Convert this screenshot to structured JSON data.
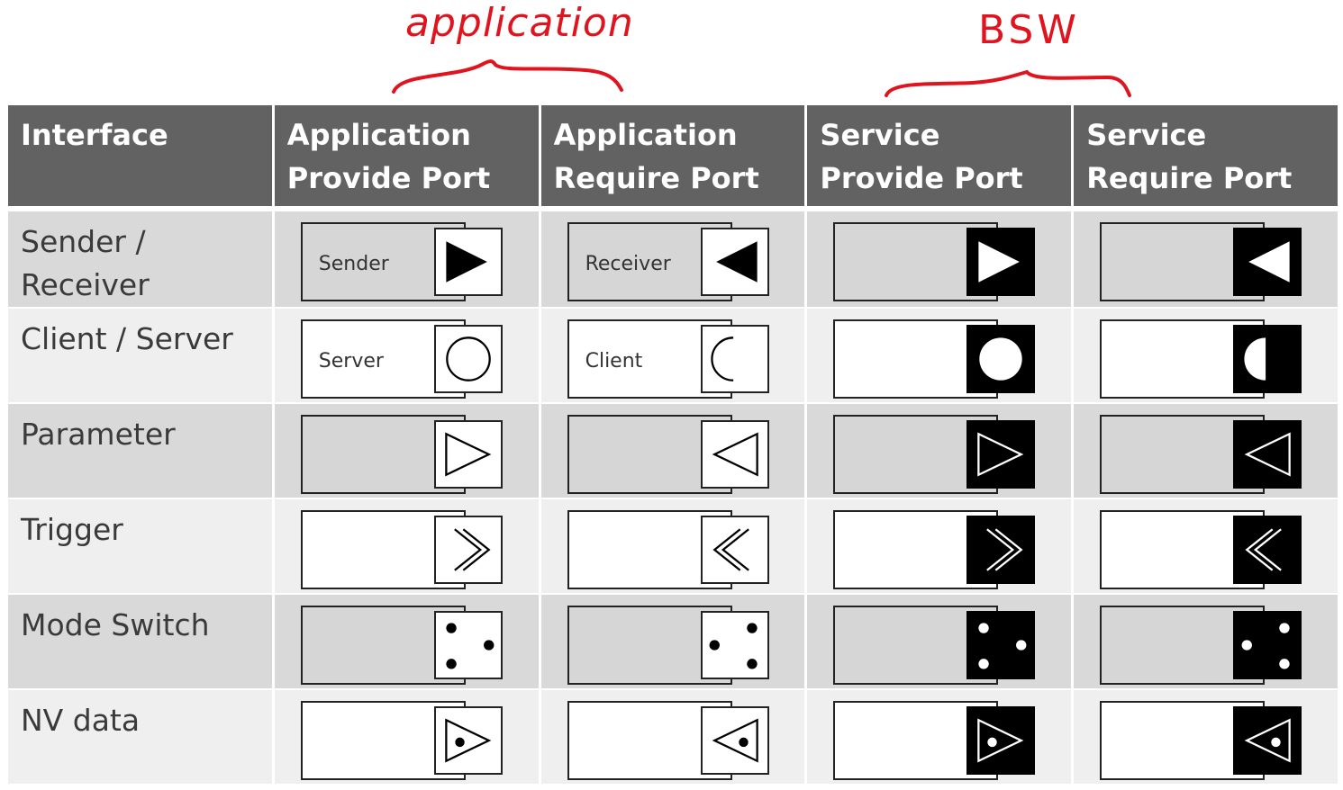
{
  "annotations": {
    "application": "application",
    "bsw": "BSW"
  },
  "colors": {
    "header_bg": "#626262",
    "row_dark": "#d9d9d9",
    "row_light": "#efefef",
    "annotation": "#e0141e"
  },
  "headers": {
    "interface": "Interface",
    "app_provide": [
      "Application",
      "Provide Port"
    ],
    "app_require": [
      "Application",
      "Require Port"
    ],
    "svc_provide": [
      "Service",
      "Provide Port"
    ],
    "svc_require": [
      "Service",
      "Require Port"
    ]
  },
  "rows": [
    {
      "interface": [
        "Sender /",
        "Receiver"
      ],
      "app_provide_label": "Sender",
      "app_require_label": "Receiver",
      "icon": "sender-receiver"
    },
    {
      "interface": [
        "Client / Server"
      ],
      "app_provide_label": "Server",
      "app_require_label": "Client",
      "icon": "client-server"
    },
    {
      "interface": [
        "Parameter"
      ],
      "app_provide_label": "",
      "app_require_label": "",
      "icon": "parameter"
    },
    {
      "interface": [
        "Trigger"
      ],
      "app_provide_label": "",
      "app_require_label": "",
      "icon": "trigger"
    },
    {
      "interface": [
        "Mode Switch"
      ],
      "app_provide_label": "",
      "app_require_label": "",
      "icon": "mode-switch"
    },
    {
      "interface": [
        "NV data"
      ],
      "app_provide_label": "",
      "app_require_label": "",
      "icon": "nv-data"
    }
  ]
}
